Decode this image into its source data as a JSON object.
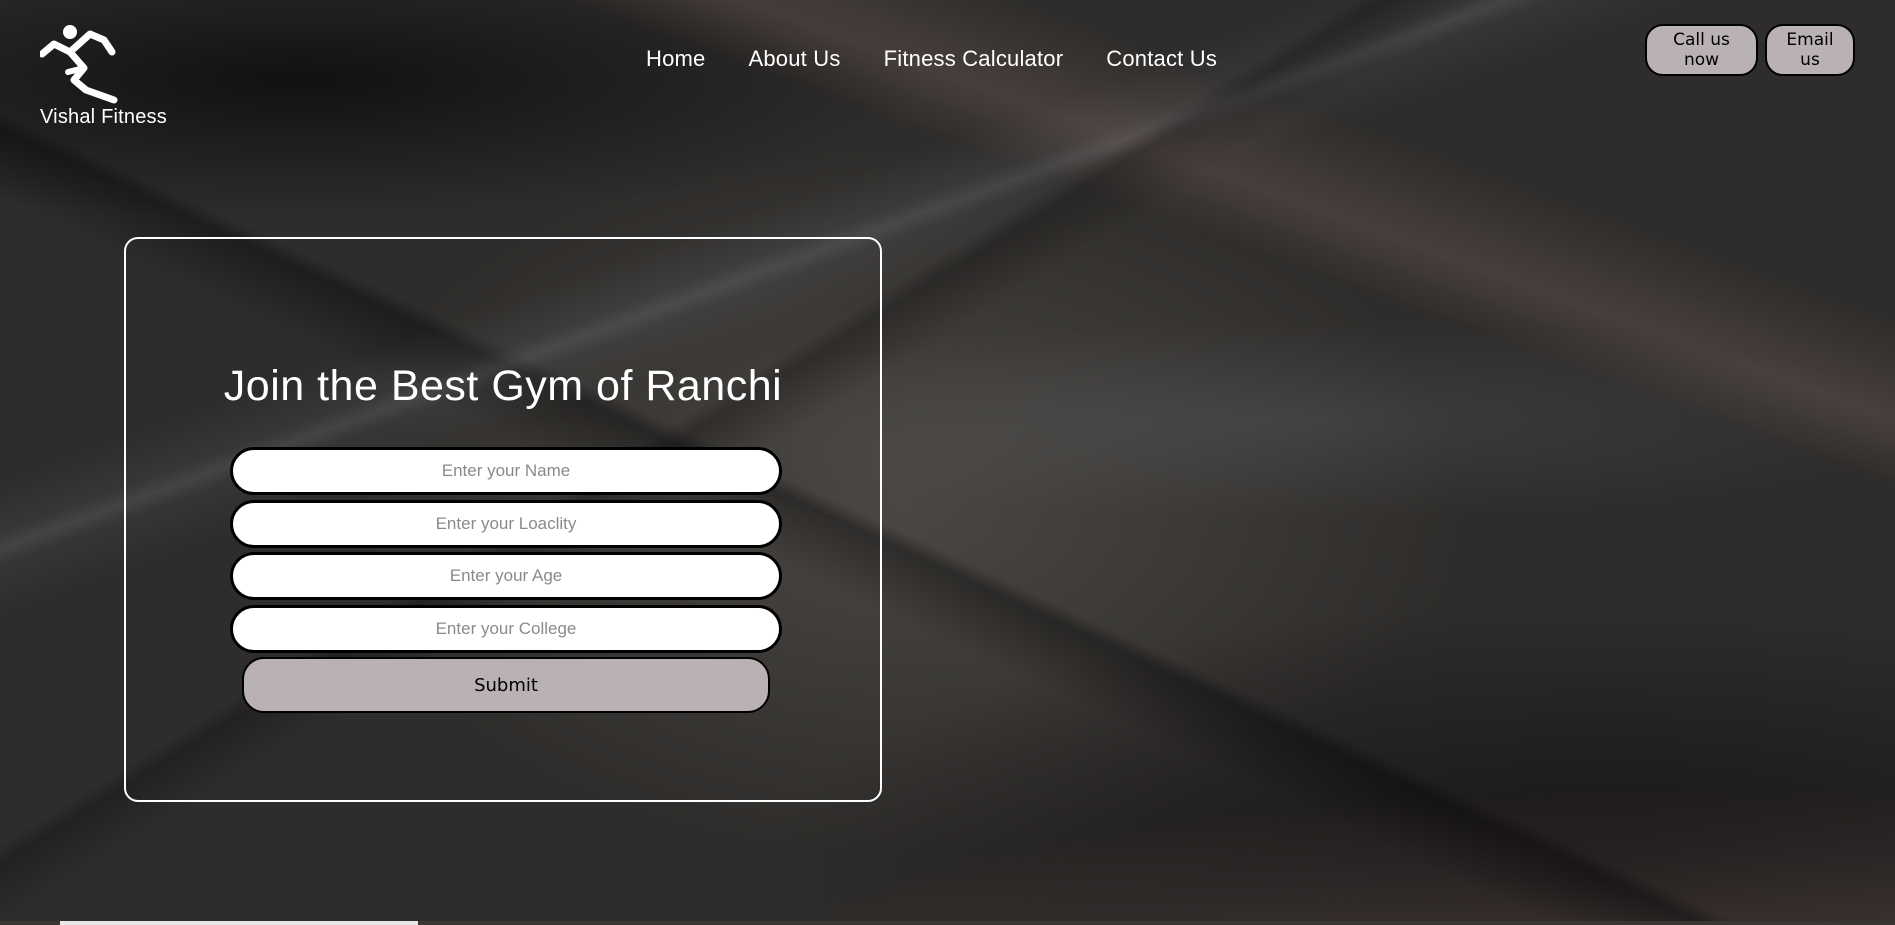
{
  "brand": {
    "name": "Vishal Fitness",
    "logo_icon": "running-figure-icon"
  },
  "nav": {
    "items": [
      {
        "label": "Home"
      },
      {
        "label": "About Us"
      },
      {
        "label": "Fitness Calculator"
      },
      {
        "label": "Contact Us"
      }
    ]
  },
  "contact": {
    "call_label": "Call us now",
    "email_label": "Email us"
  },
  "form": {
    "title": "Join the Best Gym of Ranchi",
    "fields": [
      {
        "placeholder": "Enter your Name",
        "value": ""
      },
      {
        "placeholder": "Enter your Loaclity",
        "value": ""
      },
      {
        "placeholder": "Enter your Age",
        "value": ""
      },
      {
        "placeholder": "Enter your College",
        "value": ""
      }
    ],
    "submit_label": "Submit"
  },
  "colors": {
    "button_bg": "#b9b1b2",
    "text": "#ffffff",
    "border": "#000000"
  }
}
